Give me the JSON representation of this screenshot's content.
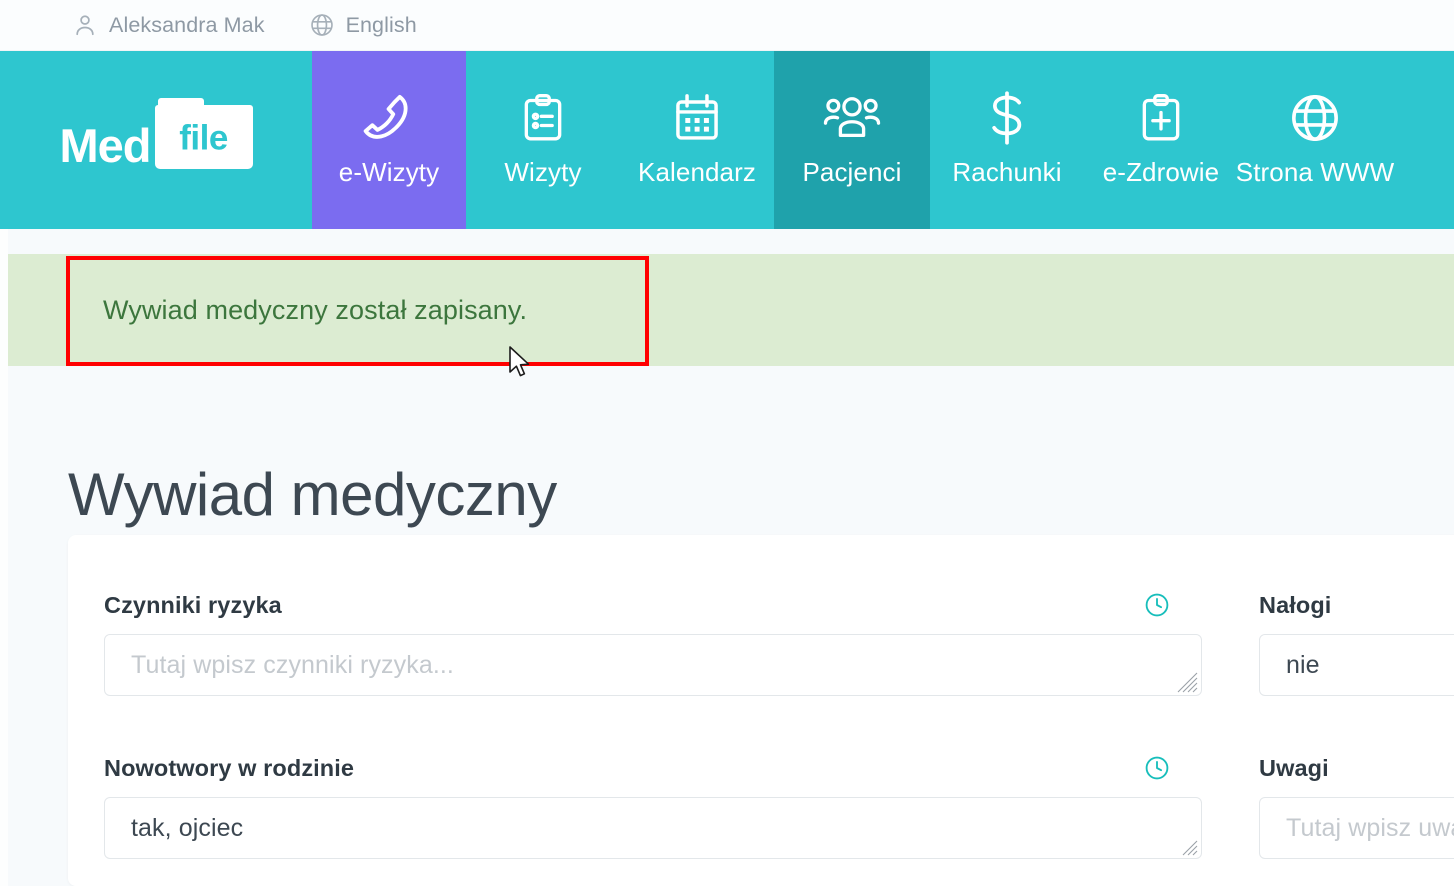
{
  "topbar": {
    "user": {
      "icon": "user-icon",
      "label": "Aleksandra Mak"
    },
    "language": {
      "icon": "globe-icon",
      "label": "English"
    }
  },
  "brand": {
    "part1": "Med",
    "part2": "file"
  },
  "nav": {
    "items": [
      {
        "label": "e-Wizyty",
        "icon": "phone-icon",
        "state": "accent"
      },
      {
        "label": "Wizyty",
        "icon": "clipboard-list-icon",
        "state": "default"
      },
      {
        "label": "Kalendarz",
        "icon": "calendar-icon",
        "state": "default"
      },
      {
        "label": "Pacjenci",
        "icon": "people-group-icon",
        "state": "active"
      },
      {
        "label": "Rachunki",
        "icon": "dollar-icon",
        "state": "default"
      },
      {
        "label": "e-Zdrowie",
        "icon": "clipboard-plus-icon",
        "state": "default"
      },
      {
        "label": "Strona WWW",
        "icon": "globe-icon",
        "state": "default"
      }
    ]
  },
  "alert": {
    "message": "Wywiad medyczny został zapisany.",
    "type": "success",
    "background_color": "#dcecd2",
    "text_color": "#3c763d"
  },
  "page": {
    "title": "Wywiad medyczny"
  },
  "form": {
    "fields": [
      {
        "label": "Czynniki ryzyka",
        "value": "",
        "placeholder": "Tutaj wpisz czynniki ryzyka...",
        "has_history_icon": true
      },
      {
        "label": "Nałogi",
        "value": "nie",
        "placeholder": "",
        "has_history_icon": false
      },
      {
        "label": "Nowotwory w rodzinie",
        "value": "tak, ojciec",
        "placeholder": "",
        "has_history_icon": true
      },
      {
        "label": "Uwagi",
        "value": "",
        "placeholder": "Tutaj wpisz uwagi...",
        "has_history_icon": false
      }
    ]
  },
  "annotation": {
    "color": "#ff0000",
    "target": "Wywiad medyczny został zapisany."
  },
  "colors": {
    "brand_teal": "#2ec6cf",
    "active_teal": "#1fa2ab",
    "accent_purple": "#7b6cf0",
    "icon_teal": "#17bebb"
  }
}
